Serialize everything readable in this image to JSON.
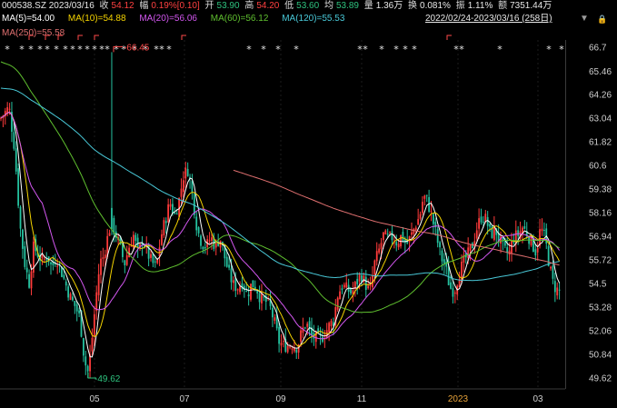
{
  "header": {
    "code_date": "000538.SZ 2023/03/16",
    "close_label": "收",
    "close_value": "54.12",
    "change_label": "幅",
    "change_value": "0.19%[0.10]",
    "open_label": "开",
    "open_value": "53.90",
    "high_label": "高",
    "high_value": "54.20",
    "low_label": "低",
    "low_value": "53.60",
    "avg_label": "均",
    "avg_value": "53.89",
    "volume_label": "量",
    "volume_value": "1.36万",
    "turnover_label": "换",
    "turnover_value": "0.081%",
    "amplitude_label": "振",
    "amplitude_value": "1.11%",
    "amount_label": "额",
    "amount_value": "7351.44万"
  },
  "ma_row1": [
    {
      "text": "MA(5)=54.00",
      "color": "#ffffff"
    },
    {
      "text": "MA(10)=54.88",
      "color": "#f5d400"
    },
    {
      "text": "MA(20)=56.06",
      "color": "#d357f0"
    },
    {
      "text": "MA(60)=56.12",
      "color": "#5fbf2f"
    },
    {
      "text": "MA(120)=55.53",
      "color": "#49c9d8"
    }
  ],
  "ma_row2": [
    {
      "text": "MA(250)=55.58",
      "color": "#e07070"
    }
  ],
  "range_label": "2022/02/24-2023/03/16 (258日)",
  "controls": {
    "dropdown_icon": "▼",
    "lock_icon": "🔒"
  },
  "colors": {
    "up": "#ff3b3b",
    "down": "#25c2a0"
  },
  "chart_data": {
    "type": "candlestick",
    "y_ticks": [
      "66.7",
      "65.46",
      "64.26",
      "63.04",
      "61.82",
      "60.6",
      "59.38",
      "58.16",
      "56.94",
      "55.72",
      "54.5",
      "53.28",
      "52.06",
      "50.84",
      "49.62"
    ],
    "x_labels": [
      "05",
      "07",
      "09",
      "11",
      "2023",
      "03"
    ],
    "ylim": [
      49.62,
      66.7
    ],
    "annotations": [
      {
        "text": "66.45",
        "value": 66.45
      },
      {
        "text": "49.62",
        "value": 49.62
      }
    ],
    "series": [
      {
        "name": "MA(5)",
        "color": "#ffffff"
      },
      {
        "name": "MA(10)",
        "color": "#f5d400"
      },
      {
        "name": "MA(20)",
        "color": "#d357f0"
      },
      {
        "name": "MA(60)",
        "color": "#5fbf2f"
      },
      {
        "name": "MA(120)",
        "color": "#49c9d8"
      },
      {
        "name": "MA(250)",
        "color": "#e07070"
      }
    ],
    "close_path": [
      [
        0,
        63.0
      ],
      [
        10,
        63.6
      ],
      [
        16,
        61.5
      ],
      [
        22,
        57.5
      ],
      [
        27,
        55.6
      ],
      [
        32,
        54.5
      ],
      [
        37,
        56.4
      ],
      [
        42,
        56.0
      ],
      [
        47,
        55.6
      ],
      [
        52,
        56.0
      ],
      [
        57,
        55.3
      ],
      [
        62,
        55.9
      ],
      [
        67,
        55.2
      ],
      [
        72,
        54.5
      ],
      [
        78,
        53.7
      ],
      [
        83,
        53.3
      ],
      [
        88,
        52.7
      ],
      [
        93,
        50.5
      ],
      [
        97,
        49.9
      ],
      [
        101,
        51.5
      ],
      [
        105,
        53.5
      ],
      [
        110,
        55.6
      ],
      [
        114,
        55.9
      ],
      [
        118,
        56.8
      ],
      [
        122,
        57.6
      ],
      [
        127,
        57.1
      ],
      [
        132,
        56.4
      ],
      [
        137,
        55.5
      ],
      [
        142,
        56.4
      ],
      [
        147,
        57.0
      ],
      [
        152,
        56.0
      ],
      [
        157,
        56.8
      ],
      [
        162,
        56.1
      ],
      [
        167,
        55.6
      ],
      [
        172,
        55.3
      ],
      [
        177,
        56.9
      ],
      [
        182,
        57.8
      ],
      [
        187,
        58.7
      ],
      [
        192,
        58.0
      ],
      [
        197,
        58.8
      ],
      [
        202,
        60.1
      ],
      [
        207,
        60.4
      ],
      [
        212,
        59.0
      ],
      [
        217,
        57.3
      ],
      [
        222,
        56.6
      ],
      [
        227,
        56.4
      ],
      [
        232,
        56.9
      ],
      [
        237,
        56.4
      ],
      [
        242,
        56.9
      ],
      [
        247,
        55.9
      ],
      [
        252,
        55.0
      ],
      [
        257,
        54.4
      ],
      [
        262,
        54.3
      ],
      [
        267,
        54.6
      ],
      [
        272,
        53.9
      ],
      [
        277,
        54.5
      ],
      [
        282,
        54.3
      ],
      [
        287,
        53.7
      ],
      [
        292,
        53.6
      ],
      [
        297,
        53.3
      ],
      [
        302,
        52.5
      ],
      [
        307,
        51.5
      ],
      [
        312,
        51.3
      ],
      [
        317,
        51.3
      ],
      [
        322,
        51.4
      ],
      [
        327,
        51.2
      ],
      [
        332,
        52.0
      ],
      [
        337,
        52.5
      ],
      [
        342,
        51.8
      ],
      [
        347,
        51.7
      ],
      [
        352,
        51.6
      ],
      [
        357,
        51.9
      ],
      [
        362,
        52.3
      ],
      [
        367,
        52.6
      ],
      [
        372,
        54.0
      ],
      [
        377,
        54.4
      ],
      [
        382,
        54.2
      ],
      [
        387,
        54.0
      ],
      [
        392,
        54.5
      ],
      [
        397,
        55.0
      ],
      [
        402,
        54.5
      ],
      [
        407,
        54.0
      ],
      [
        412,
        55.5
      ],
      [
        417,
        56.2
      ],
      [
        422,
        57.0
      ],
      [
        427,
        56.8
      ],
      [
        432,
        56.9
      ],
      [
        437,
        56.6
      ],
      [
        442,
        57.0
      ],
      [
        447,
        56.5
      ],
      [
        452,
        56.9
      ],
      [
        457,
        57.5
      ],
      [
        462,
        58.0
      ],
      [
        466,
        59.0
      ],
      [
        470,
        58.8
      ],
      [
        475,
        58.0
      ],
      [
        480,
        57.0
      ],
      [
        485,
        55.9
      ],
      [
        490,
        55.4
      ],
      [
        495,
        54.3
      ],
      [
        500,
        54.1
      ],
      [
        505,
        55.0
      ],
      [
        510,
        55.6
      ],
      [
        515,
        56.0
      ],
      [
        520,
        56.5
      ],
      [
        525,
        57.4
      ],
      [
        530,
        58.0
      ],
      [
        535,
        57.8
      ],
      [
        540,
        57.0
      ],
      [
        545,
        57.3
      ],
      [
        550,
        56.7
      ],
      [
        555,
        56.2
      ],
      [
        560,
        56.0
      ],
      [
        565,
        56.9
      ],
      [
        570,
        57.0
      ],
      [
        575,
        57.4
      ],
      [
        580,
        57.1
      ],
      [
        585,
        56.6
      ],
      [
        590,
        56.1
      ],
      [
        595,
        57.4
      ],
      [
        600,
        56.8
      ],
      [
        604,
        55.6
      ],
      [
        608,
        54.6
      ],
      [
        612,
        54.2
      ],
      [
        617,
        54.1
      ]
    ]
  }
}
